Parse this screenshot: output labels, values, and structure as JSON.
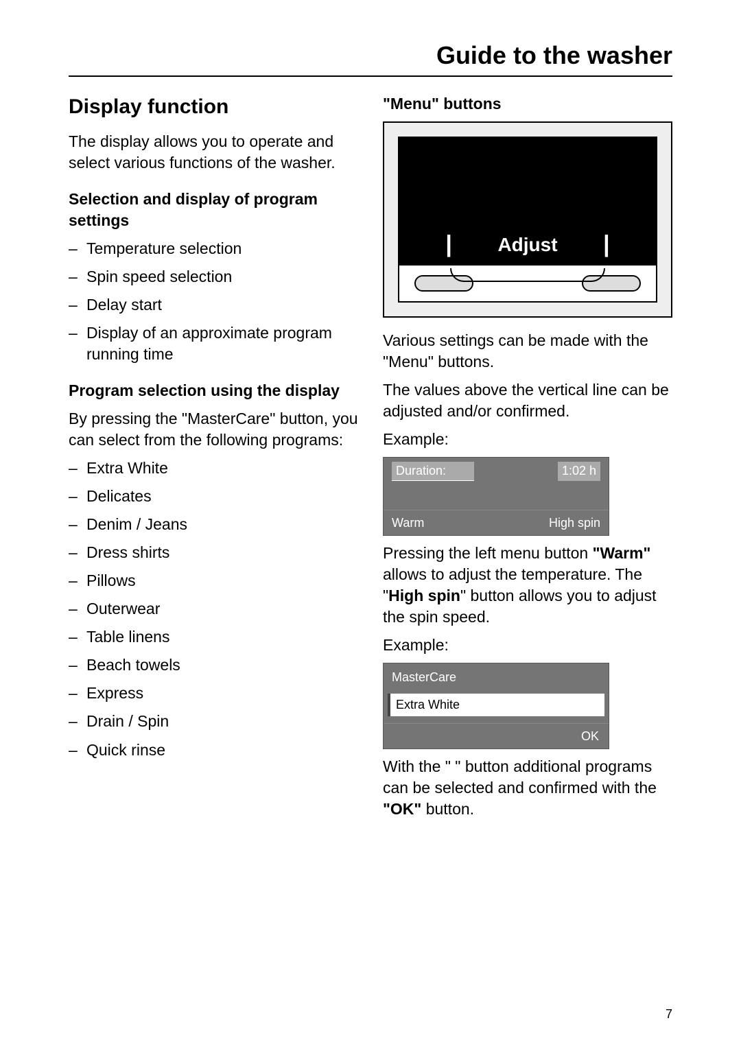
{
  "header": {
    "title": "Guide to the washer"
  },
  "left": {
    "heading": "Display function",
    "intro": "The display allows you to operate and select various functions of the washer.",
    "sub1": "Selection and display of program settings",
    "settings": [
      "Temperature selection",
      "Spin speed selection",
      "Delay start",
      "Display of an approximate program running time"
    ],
    "sub2": "Program selection using the display",
    "program_intro": "By pressing the \"MasterCare\" button, you can select from the following programs:",
    "programs": [
      "Extra White",
      "Delicates",
      "Denim / Jeans",
      "Dress shirts",
      "Pillows",
      "Outerwear",
      "Table linens",
      "Beach towels",
      "Express",
      "Drain / Spin",
      "Quick rinse"
    ]
  },
  "right": {
    "heading": "\"Menu\" buttons",
    "diagram": {
      "label": "Adjust"
    },
    "para1": "Various settings can be made with the \"Menu\" buttons.",
    "para2": "The values above the vertical line can be adjusted and/or confirmed.",
    "example_label": "Example:",
    "disp1": {
      "duration_label": "Duration:",
      "duration_value": "1:02  h",
      "left_btn": "Warm",
      "right_btn": "High spin"
    },
    "para3_a": "Pressing the left menu button ",
    "para3_b": "\"Warm\"",
    "para3_c": " allows to adjust the temperature.  The \"",
    "para3_d": "High spin",
    "para3_e": "\" button allows you to adjust the spin speed.",
    "disp2": {
      "title": "MasterCare",
      "selected": "Extra White",
      "ok": "OK"
    },
    "para4_a": "With the \"    \" button additional programs can be selected and confirmed with the ",
    "para4_b": "\"OK\"",
    "para4_c": " button."
  },
  "page_number": "7"
}
